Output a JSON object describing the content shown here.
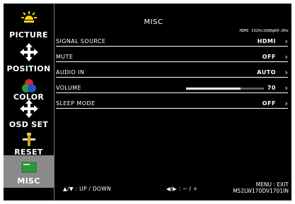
{
  "sidebar": {
    "items": [
      {
        "label": "PICTURE",
        "icon": "sun-icon",
        "active": false
      },
      {
        "label": "POSITION",
        "icon": "move-arrows-icon",
        "active": false
      },
      {
        "label": "COLOR",
        "icon": "rgb-circles-icon",
        "active": false
      },
      {
        "label": "OSD SET",
        "icon": "osd-move-arrows-icon",
        "active": false
      },
      {
        "label": "RESET",
        "icon": "reset-tools-icon",
        "active": false
      },
      {
        "label": "MISC",
        "icon": "misc-screen-icon",
        "active": true
      }
    ]
  },
  "header": {
    "title": "MISC",
    "signal_info": "HDMI  1920x1080@60.0Hz"
  },
  "menu": {
    "rows": [
      {
        "label": "SIGNAL SOURCE",
        "value": "HDMI"
      },
      {
        "label": "MUTE",
        "value": "OFF"
      },
      {
        "label": "AUDIO  IN",
        "value": "AUTO"
      },
      {
        "label": "VOLUME",
        "value": "70",
        "level": 0.7
      },
      {
        "label": "SLEEP MODE",
        "value": "OFF"
      }
    ]
  },
  "footer": {
    "nav_hint": "▲/▼ : UP / DOWN",
    "adjust_hint": "◀/▶ : − / +",
    "exit_hint": "MENU : EXIT",
    "model": "M52LW170DV1701IN"
  },
  "colors": {
    "background": "#000000",
    "text": "#ffffff",
    "active_item": "#8a8a8a",
    "divider": "#ffffff"
  }
}
